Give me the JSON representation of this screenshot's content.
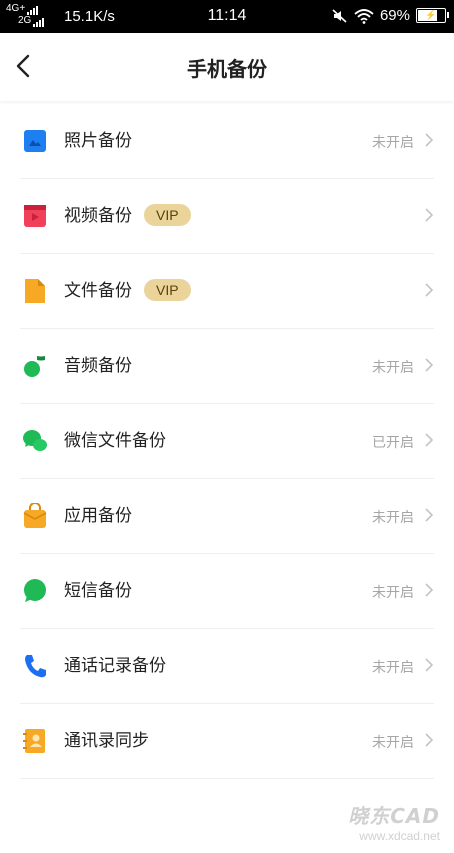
{
  "status_bar": {
    "network_top": "4G+",
    "network_bottom": "2G",
    "speed": "15.1K/s",
    "time": "11:14",
    "battery": "69%"
  },
  "header": {
    "title": "手机备份"
  },
  "vip_label": "VIP",
  "items": [
    {
      "label": "照片备份",
      "status": "未开启",
      "vip": false,
      "icon": "photo-icon",
      "color": "#1e7ff0"
    },
    {
      "label": "视频备份",
      "status": "",
      "vip": true,
      "icon": "video-icon",
      "color": "#f0405a"
    },
    {
      "label": "文件备份",
      "status": "",
      "vip": true,
      "icon": "file-icon",
      "color": "#f7a925"
    },
    {
      "label": "音频备份",
      "status": "未开启",
      "vip": false,
      "icon": "music-icon",
      "color": "#1fb955"
    },
    {
      "label": "微信文件备份",
      "status": "已开启",
      "vip": false,
      "icon": "wechat-icon",
      "color": "#1fb955"
    },
    {
      "label": "应用备份",
      "status": "未开启",
      "vip": false,
      "icon": "app-bag-icon",
      "color": "#f7a925"
    },
    {
      "label": "短信备份",
      "status": "未开启",
      "vip": false,
      "icon": "sms-icon",
      "color": "#1fb955"
    },
    {
      "label": "通话记录备份",
      "status": "未开启",
      "vip": false,
      "icon": "phone-icon",
      "color": "#1e6ff0"
    },
    {
      "label": "通讯录同步",
      "status": "未开启",
      "vip": false,
      "icon": "contacts-icon",
      "color": "#f7a925"
    }
  ],
  "watermark": {
    "main": "晓东CAD",
    "url": "www.xdcad.net"
  }
}
